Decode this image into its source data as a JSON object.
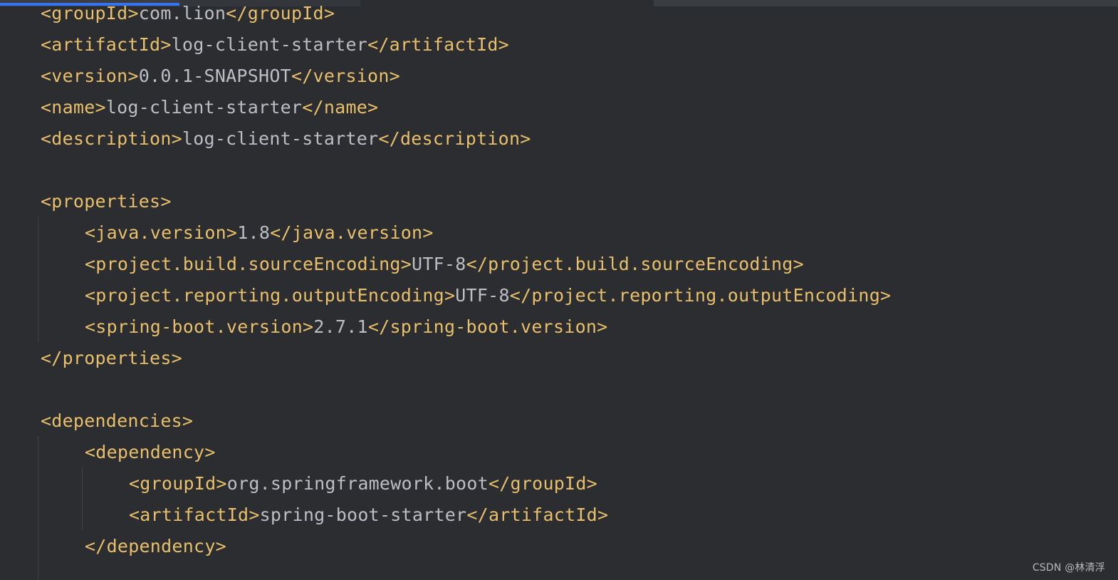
{
  "editor": {
    "colors": {
      "background": "#2b2d30",
      "tag": "#e8bf6a",
      "text": "#bcbec4",
      "tab_accent": "#3574f0"
    },
    "lines": [
      {
        "open": "<groupId>",
        "value": "com.lion",
        "close": "</groupId>"
      },
      {
        "open": "<artifactId>",
        "value": "log-client-starter",
        "close": "</artifactId>"
      },
      {
        "open": "<version>",
        "value": "0.0.1-SNAPSHOT",
        "close": "</version>"
      },
      {
        "open": "<name>",
        "value": "log-client-starter",
        "close": "</name>"
      },
      {
        "open": "<description>",
        "value": "log-client-starter",
        "close": "</description>"
      },
      {
        "open": "<properties>",
        "value": "",
        "close": ""
      },
      {
        "open": "<java.version>",
        "value": "1.8",
        "close": "</java.version>"
      },
      {
        "open": "<project.build.sourceEncoding>",
        "value": "UTF-8",
        "close": "</project.build.sourceEncoding>"
      },
      {
        "open": "<project.reporting.outputEncoding>",
        "value": "UTF-8",
        "close": "</project.reporting.outputEncoding>"
      },
      {
        "open": "<spring-boot.version>",
        "value": "2.7.1",
        "close": "</spring-boot.version>"
      },
      {
        "open": "</properties>",
        "value": "",
        "close": ""
      },
      {
        "open": "<dependencies>",
        "value": "",
        "close": ""
      },
      {
        "open": "<dependency>",
        "value": "",
        "close": ""
      },
      {
        "open": "<groupId>",
        "value": "org.springframework.boot",
        "close": "</groupId>"
      },
      {
        "open": "<artifactId>",
        "value": "spring-boot-starter",
        "close": "</artifactId>"
      },
      {
        "open": "</dependency>",
        "value": "",
        "close": ""
      }
    ]
  },
  "watermark": "CSDN @林清浮"
}
